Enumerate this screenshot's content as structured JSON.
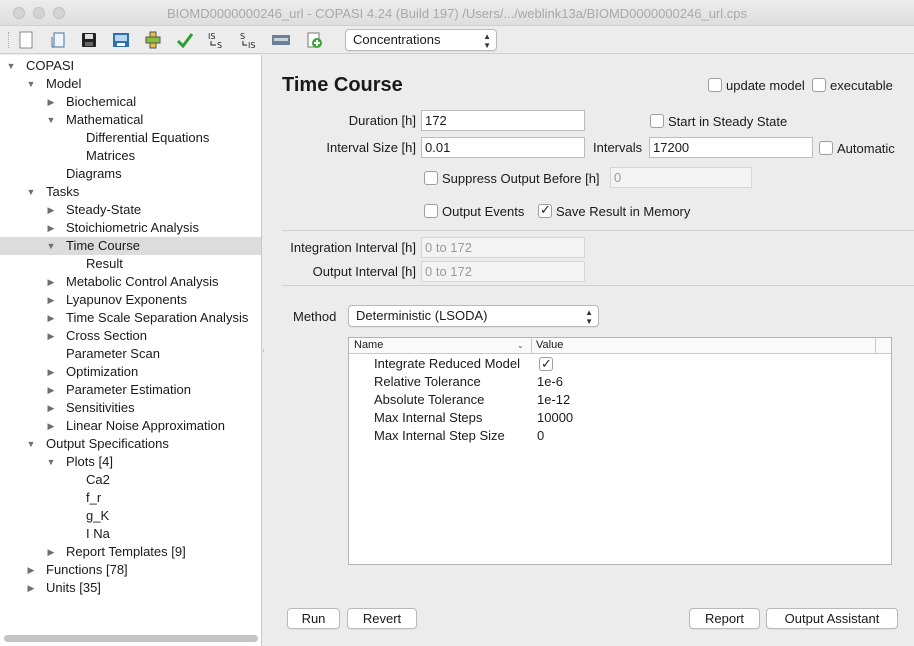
{
  "window": {
    "title": "BIOMD0000000246_url - COPASI 4.24 (Build 197) /Users/.../weblink13a/BIOMD0000000246_url.cps"
  },
  "toolbar": {
    "icons": [
      "new-file-icon",
      "open-file-icon",
      "save-icon",
      "save-as-icon",
      "check-icon",
      "apply-icon",
      "is-to-s-icon",
      "s-to-is-icon",
      "sbml-icon",
      "add-icon"
    ],
    "quantity_combo": "Concentrations"
  },
  "tree": {
    "items": [
      {
        "label": "COPASI",
        "level": 0,
        "arrow": "down"
      },
      {
        "label": "Model",
        "level": 1,
        "arrow": "down"
      },
      {
        "label": "Biochemical",
        "level": 2,
        "arrow": "right"
      },
      {
        "label": "Mathematical",
        "level": 2,
        "arrow": "down"
      },
      {
        "label": "Differential Equations",
        "level": 3,
        "arrow": ""
      },
      {
        "label": "Matrices",
        "level": 3,
        "arrow": ""
      },
      {
        "label": "Diagrams",
        "level": 2,
        "arrow": ""
      },
      {
        "label": "Tasks",
        "level": 1,
        "arrow": "down"
      },
      {
        "label": "Steady-State",
        "level": 2,
        "arrow": "right"
      },
      {
        "label": "Stoichiometric Analysis",
        "level": 2,
        "arrow": "right"
      },
      {
        "label": "Time Course",
        "level": 2,
        "arrow": "down",
        "selected": true
      },
      {
        "label": "Result",
        "level": 3,
        "arrow": ""
      },
      {
        "label": "Metabolic Control Analysis",
        "level": 2,
        "arrow": "right"
      },
      {
        "label": "Lyapunov Exponents",
        "level": 2,
        "arrow": "right"
      },
      {
        "label": "Time Scale Separation Analysis",
        "level": 2,
        "arrow": "right"
      },
      {
        "label": "Cross Section",
        "level": 2,
        "arrow": "right"
      },
      {
        "label": "Parameter Scan",
        "level": 2,
        "arrow": ""
      },
      {
        "label": "Optimization",
        "level": 2,
        "arrow": "right"
      },
      {
        "label": "Parameter Estimation",
        "level": 2,
        "arrow": "right"
      },
      {
        "label": "Sensitivities",
        "level": 2,
        "arrow": "right"
      },
      {
        "label": "Linear Noise Approximation",
        "level": 2,
        "arrow": "right"
      },
      {
        "label": "Output Specifications",
        "level": 1,
        "arrow": "down"
      },
      {
        "label": "Plots [4]",
        "level": 2,
        "arrow": "down"
      },
      {
        "label": "Ca2",
        "level": 3,
        "arrow": ""
      },
      {
        "label": "f_r",
        "level": 3,
        "arrow": ""
      },
      {
        "label": "g_K",
        "level": 3,
        "arrow": ""
      },
      {
        "label": "I Na",
        "level": 3,
        "arrow": ""
      },
      {
        "label": "Report Templates [9]",
        "level": 2,
        "arrow": "right"
      },
      {
        "label": "Functions [78]",
        "level": 1,
        "arrow": "right"
      },
      {
        "label": "Units [35]",
        "level": 1,
        "arrow": "right"
      }
    ]
  },
  "task": {
    "heading": "Time Course",
    "update_model_label": "update model",
    "update_model_checked": false,
    "executable_label": "executable",
    "executable_checked": false,
    "duration_label": "Duration [h]",
    "duration_value": "172",
    "start_steady_label": "Start in Steady State",
    "start_steady_checked": false,
    "interval_size_label": "Interval Size [h]",
    "interval_size_value": "0.01",
    "intervals_label": "Intervals",
    "intervals_value": "17200",
    "automatic_label": "Automatic",
    "automatic_checked": false,
    "suppress_label": "Suppress Output Before [h]",
    "suppress_checked": false,
    "suppress_value": "0",
    "output_events_label": "Output Events",
    "output_events_checked": false,
    "save_result_label": "Save Result in Memory",
    "save_result_checked": true,
    "integration_interval_label": "Integration Interval [h]",
    "integration_interval_value": "0 to 172",
    "output_interval_label": "Output Interval [h]",
    "output_interval_value": "0 to 172"
  },
  "method": {
    "label": "Method",
    "value": "Deterministic (LSODA)",
    "columns": [
      "Name",
      "Value"
    ],
    "rows": [
      {
        "name": "Integrate Reduced Model",
        "value": "",
        "checkbox": true,
        "checked": true
      },
      {
        "name": "Relative Tolerance",
        "value": "1e-6"
      },
      {
        "name": "Absolute Tolerance",
        "value": "1e-12"
      },
      {
        "name": "Max Internal Steps",
        "value": "10000"
      },
      {
        "name": "Max Internal Step Size",
        "value": "0"
      }
    ]
  },
  "buttons": {
    "run": "Run",
    "revert": "Revert",
    "report": "Report",
    "output_assistant": "Output Assistant"
  }
}
